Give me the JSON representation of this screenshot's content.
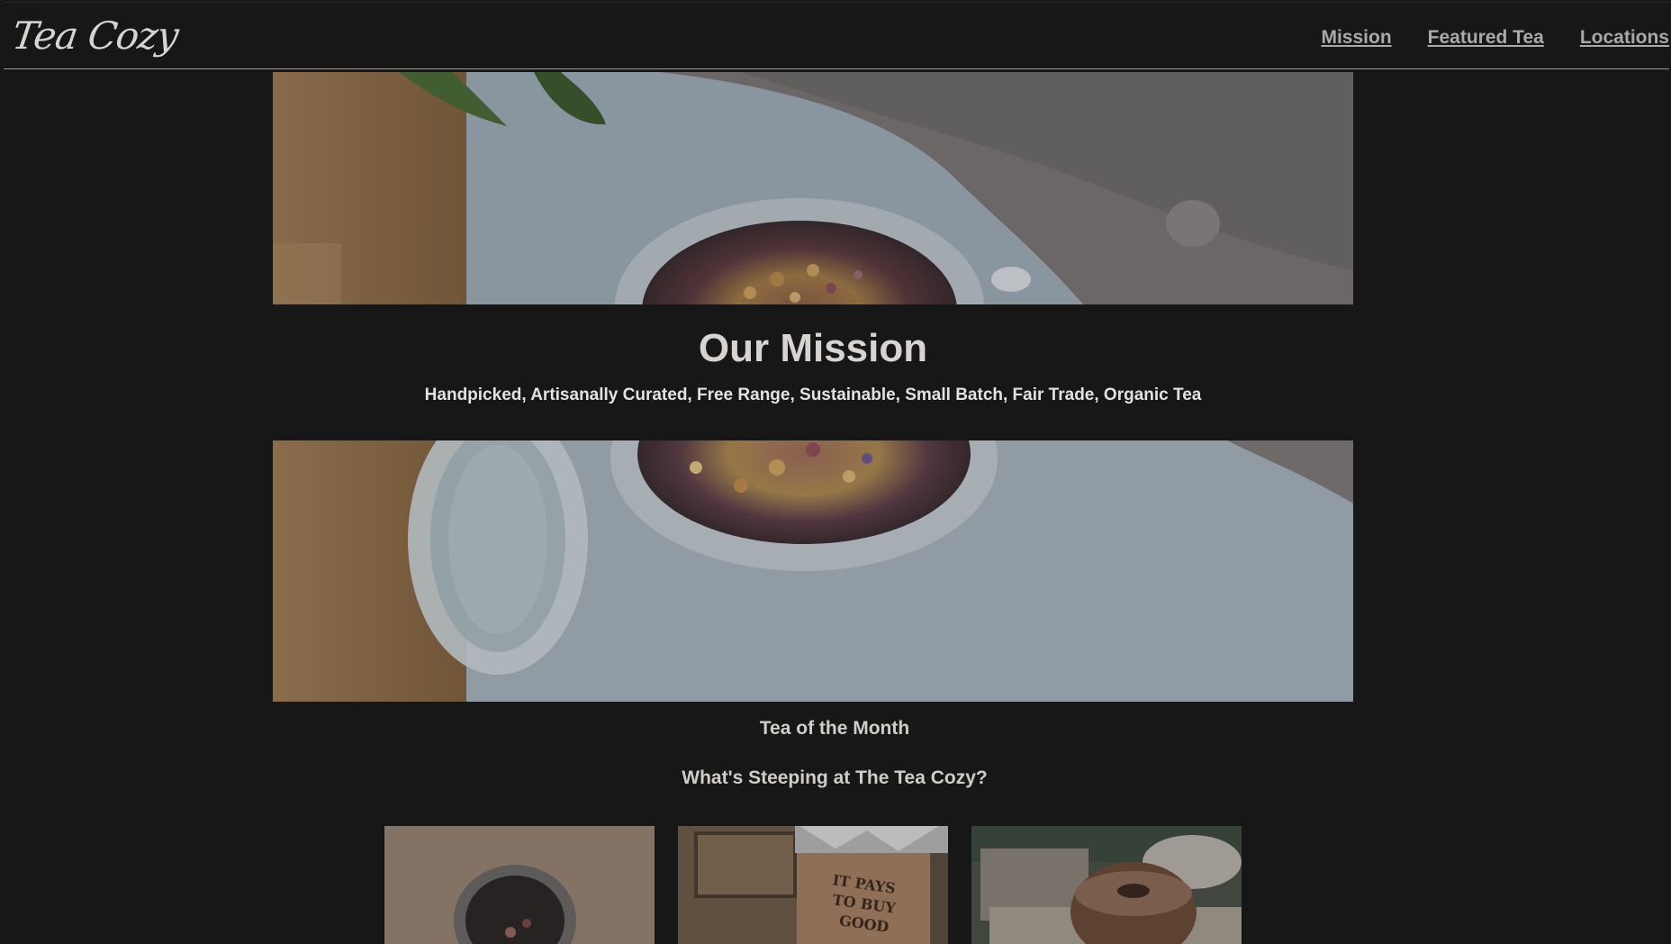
{
  "header": {
    "logo": "Tea Cozy",
    "nav": [
      {
        "label": "Mission"
      },
      {
        "label": "Featured Tea"
      },
      {
        "label": "Locations"
      }
    ]
  },
  "mission": {
    "title": "Our Mission",
    "subtitle": "Handpicked, Artisanally Curated, Free Range, Sustainable, Small Batch, Fair Trade, Organic Tea"
  },
  "featured": {
    "heading": "Tea of the Month",
    "subheading": "What's Steeping at The Tea Cozy?"
  },
  "images": {
    "crate_text": "IT PAYS TO BUY GOOD"
  }
}
